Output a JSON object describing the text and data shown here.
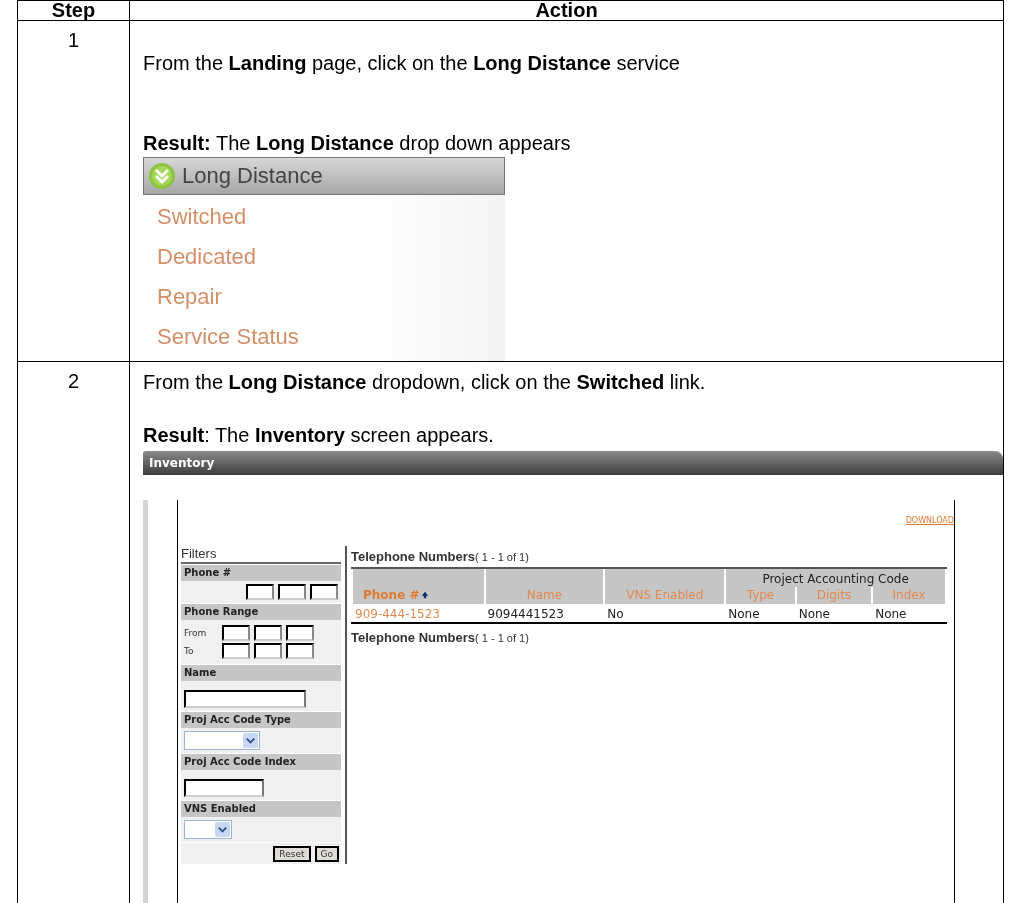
{
  "table": {
    "columns": [
      "Step",
      "Action"
    ],
    "rows": [
      {
        "step": "1",
        "instruction": "From the **Landing** page, click on the **Long Distance** service",
        "result": "**Result:**  The **Long Distance** drop down appears",
        "screenshot": {
          "kind": "dropdown",
          "header": "Long Distance",
          "items": [
            "Switched",
            "Dedicated",
            "Repair",
            "Service Status"
          ]
        }
      },
      {
        "step": "2",
        "instruction": "From the **Long Distance** dropdown, click on the **Switched** link.",
        "result": "**Result**:  The **Inventory** screen appears.",
        "screenshot": {
          "kind": "inventory",
          "title": "Inventory",
          "download": "DOWNLOAD",
          "filters": {
            "heading": "Filters",
            "sections": [
              {
                "label": "Phone #",
                "kind": "phone"
              },
              {
                "label": "Phone Range",
                "kind": "range",
                "from": "From",
                "to": "To"
              },
              {
                "label": "Name",
                "kind": "field"
              },
              {
                "label": "Proj Acc Code Type",
                "kind": "select"
              },
              {
                "label": "Proj Acc Code Index",
                "kind": "smallfield"
              },
              {
                "label": "VNS Enabled",
                "kind": "smallselect"
              }
            ],
            "buttons": [
              "Reset",
              "Go"
            ]
          },
          "results": {
            "caption": "Telephone Numbers",
            "range": "( 1 - 1 of 1)",
            "columns": [
              {
                "label": "Phone #",
                "sorted": true
              },
              {
                "label": "Name",
                "sorted": false
              },
              {
                "label": "VNS Enabled",
                "sorted": false
              }
            ],
            "group": {
              "label": "Project Accounting Code",
              "columns": [
                {
                  "label": "Type"
                },
                {
                  "label": "Digits"
                },
                {
                  "label": "Index"
                }
              ]
            },
            "rows": [
              [
                "909-444-1523",
                "9094441523",
                "No",
                "None",
                "None",
                "None"
              ]
            ],
            "footer_caption": "Telephone Numbers",
            "footer_range": "( 1 - 1 of 1)"
          }
        }
      }
    ]
  }
}
